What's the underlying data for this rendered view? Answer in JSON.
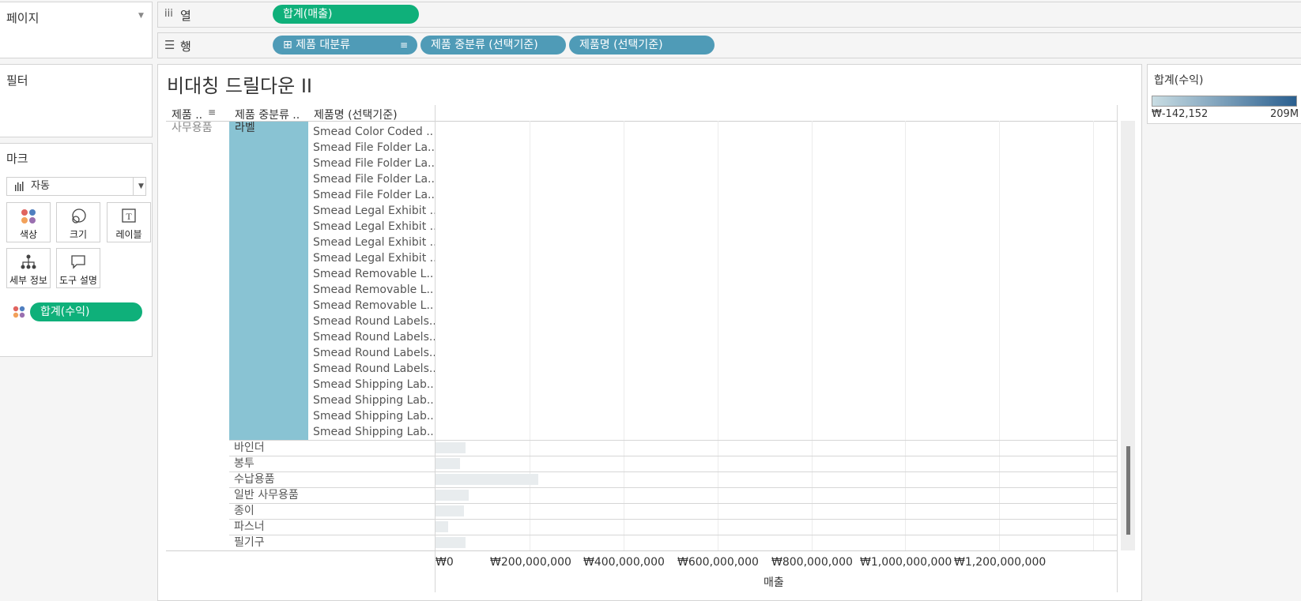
{
  "left_panel": {
    "pages_label": "페이지",
    "filters_label": "필터",
    "marks_label": "마크",
    "mark_type": "자동",
    "mark_buttons": [
      "색상",
      "크기",
      "레이블",
      "세부 정보",
      "도구 설명"
    ],
    "color_pill": "합계(수익)"
  },
  "shelves": {
    "columns_label": "열",
    "columns_pill": "합계(매출)",
    "rows_label": "행",
    "rows_pills": [
      "⊞ 제품 대분류",
      "제품 중분류 (선택기준)",
      "제품명 (선택기준)"
    ]
  },
  "view": {
    "title": "비대칭 드릴다운 II",
    "headers": [
      "제품 ..",
      "제품 중분류 ..",
      "제품명 (선택기준)"
    ],
    "category_top": "사무용품",
    "subcategory_expanded": "라벨",
    "products": [
      "Smead Color Coded ..",
      "Smead File Folder La..",
      "Smead File Folder La..",
      "Smead File Folder La..",
      "Smead File Folder La..",
      "Smead Legal Exhibit ..",
      "Smead Legal Exhibit ..",
      "Smead Legal Exhibit ..",
      "Smead Legal Exhibit ..",
      "Smead Removable L..",
      "Smead Removable L..",
      "Smead Removable L..",
      "Smead Round Labels..",
      "Smead Round Labels..",
      "Smead Round Labels..",
      "Smead Round Labels..",
      "Smead Shipping Lab..",
      "Smead Shipping Lab..",
      "Smead Shipping Lab..",
      "Smead Shipping Lab.."
    ],
    "subcategories": [
      "바인더",
      "봉투",
      "수납용품",
      "일반 사무용품",
      "종이",
      "파스너",
      "필기구"
    ]
  },
  "chart_data": {
    "type": "bar",
    "orientation": "horizontal",
    "categories": [
      "바인더",
      "봉투",
      "수납용품",
      "일반 사무용품",
      "종이",
      "파스너",
      "필기구"
    ],
    "values": [
      55000000,
      45000000,
      190000000,
      62000000,
      52000000,
      24000000,
      55000000
    ],
    "xlabel": "매출",
    "xlim": [
      0,
      1260000000
    ],
    "x_ticks": [
      "₩0",
      "₩200,000,000",
      "₩400,000,000",
      "₩600,000,000",
      "₩800,000,000",
      "₩1,000,000,000",
      "₩1,200,000,000"
    ]
  },
  "legend": {
    "title": "합계(수익)",
    "min": "₩-142,152",
    "max": "209M",
    "color_low": "#c9dde3",
    "color_high": "#2a5f8f"
  }
}
